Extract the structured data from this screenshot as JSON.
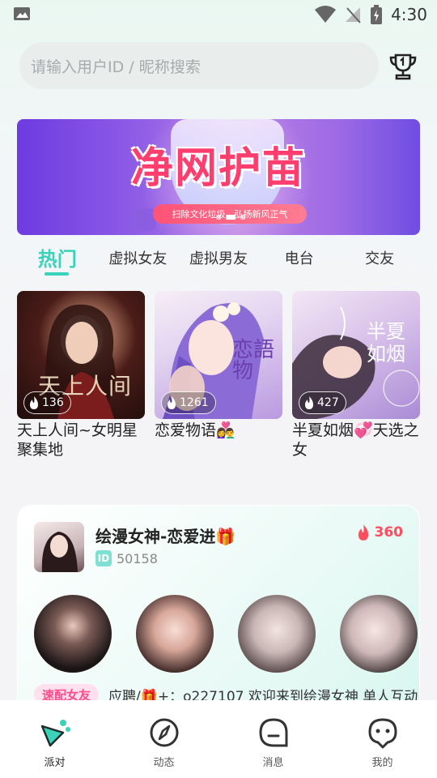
{
  "status_bar": {
    "time": "4:30"
  },
  "search": {
    "placeholder": "请输入用户ID / 昵称搜索"
  },
  "banner": {
    "title": "净网护苗",
    "subtitle": "扫除文化垃圾，弘扬新风正气"
  },
  "tabs": [
    {
      "label": "热门",
      "active": true
    },
    {
      "label": "虚拟女友"
    },
    {
      "label": "虚拟男友"
    },
    {
      "label": "电台"
    },
    {
      "label": "交友"
    }
  ],
  "cards": [
    {
      "title": "天上人间~女明星聚集地",
      "hot": "136",
      "image_text": "天上人间"
    },
    {
      "title": "恋爱物语👩‍❤️‍👨",
      "hot": "1261",
      "image_text": "恋語物"
    },
    {
      "title": "半夏如烟💞天选之女",
      "hot": "427",
      "image_text": "半夏如烟"
    }
  ],
  "party": {
    "name": "绘漫女神-恋爱进🎁",
    "id_label": "ID",
    "id": "50158",
    "hot": "360",
    "recruit_tag": "速配女友",
    "recruit_text": "应聘/🎁+：o227107 欢迎来到绘漫女神 单人互动"
  },
  "bottom_nav": [
    {
      "label": "派对",
      "icon": "party-icon",
      "active": true
    },
    {
      "label": "动态",
      "icon": "compass-icon"
    },
    {
      "label": "消息",
      "icon": "message-icon"
    },
    {
      "label": "我的",
      "icon": "profile-icon"
    }
  ],
  "colors": {
    "accent": "#3ad2b8",
    "hot": "#ff4d5e",
    "recruit": "#ff4c8c"
  }
}
